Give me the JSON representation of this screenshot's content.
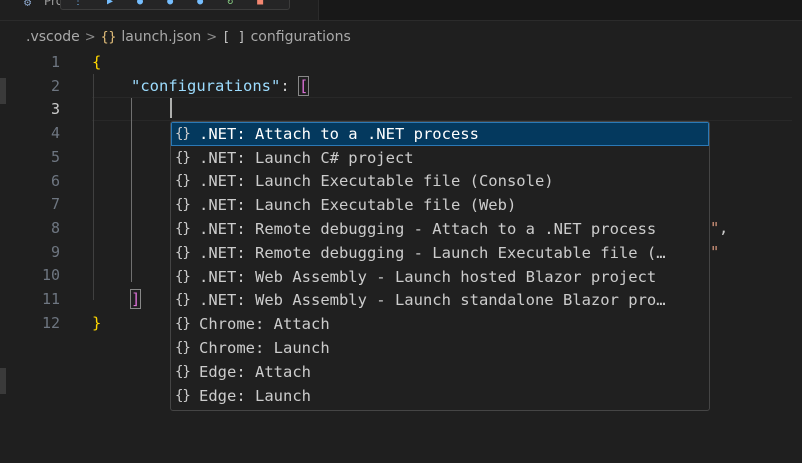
{
  "tab": {
    "label": "Pro"
  },
  "breadcrumb": {
    "folder": ".vscode",
    "file": "launch.json",
    "json_icon": "{}",
    "array_icon": "[ ]",
    "symbol": "configurations"
  },
  "editor": {
    "active_line": 3,
    "line_numbers": [
      "1",
      "2",
      "3",
      "4",
      "5",
      "6",
      "7",
      "8",
      "9",
      "10",
      "11",
      "12"
    ],
    "line1_open_brace": "{",
    "line2_key": "\"configurations\"",
    "line2_colon": ": ",
    "line2_bracket": "[",
    "line11_bracket": "]",
    "line12_close_brace": "}",
    "ghost_line8_quote": "\"",
    "ghost_line8_comma": ",",
    "ghost_line9_quote": "\""
  },
  "suggestions": {
    "icon_glyph": "{}",
    "selected_index": 0,
    "items": [
      ".NET: Attach to a .NET process",
      ".NET: Launch C# project",
      ".NET: Launch Executable file (Console)",
      ".NET: Launch Executable file (Web)",
      ".NET: Remote debugging - Attach to a .NET process",
      ".NET: Remote debugging - Launch Executable file (…",
      ".NET: Web Assembly - Launch hosted Blazor project",
      ".NET: Web Assembly - Launch standalone Blazor pro…",
      "Chrome: Attach",
      "Chrome: Launch",
      "Edge: Attach",
      "Edge: Launch"
    ]
  },
  "colors": {
    "background": "#1f1f1f",
    "selected_suggestion": "#04395e",
    "json_key": "#9cdcfe",
    "brace": "#ffd700",
    "bracket": "#da70d6"
  }
}
